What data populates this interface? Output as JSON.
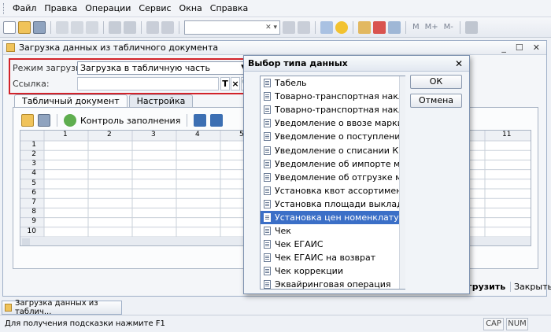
{
  "menu": [
    "Файл",
    "Правка",
    "Операции",
    "Сервис",
    "Окна",
    "Справка"
  ],
  "toolbar": {
    "memory_buttons": [
      "M",
      "M+",
      "M-"
    ]
  },
  "window": {
    "title": "Загрузка данных из табличного документа",
    "load_mode_label": "Режим загрузки:",
    "load_mode_value": "Загрузка в табличную часть",
    "link_label": "Ссылка:",
    "link_value": "",
    "link_buttons": [
      "T",
      "×",
      "🔍"
    ],
    "tabs": [
      "Табличный документ",
      "Настройка"
    ],
    "fill_check_label": "Контроль заполнения",
    "column_headers": [
      "1",
      "2",
      "3",
      "4",
      "5",
      "11"
    ],
    "row_numbers": [
      "1",
      "2",
      "3",
      "4",
      "5",
      "6",
      "7",
      "8",
      "9",
      "10"
    ],
    "load_button": "грузить",
    "close_button": "Закрыть"
  },
  "dialog": {
    "title": "Выбор типа данных",
    "items": [
      "Табель",
      "Товарно-транспортная наклад...",
      "Товарно-транспортная наклад...",
      "Уведомление о ввозе маркир...",
      "Уведомление о поступлении м...",
      "Уведомление о списании КиЗ ...",
      "Уведомление об импорте мар...",
      "Уведомление об отгрузке мар...",
      "Установка квот ассортимента",
      "Установка площади выкладки",
      "Установка цен номенклатуры",
      "Чек",
      "Чек ЕГАИС",
      "Чек ЕГАИС на возврат",
      "Чек коррекции",
      "Эквайринговая операция"
    ],
    "selected_index": 10,
    "ok_button": "ОК",
    "cancel_button": "Отмена"
  },
  "taskbar": {
    "item": "Загрузка данных из таблич..."
  },
  "status": {
    "hint": "Для получения подсказки нажмите F1",
    "caps": "CAP",
    "num": "NUM"
  },
  "colors": {
    "highlight_frame": "#d2232a",
    "selection": "#3b6fc7"
  }
}
